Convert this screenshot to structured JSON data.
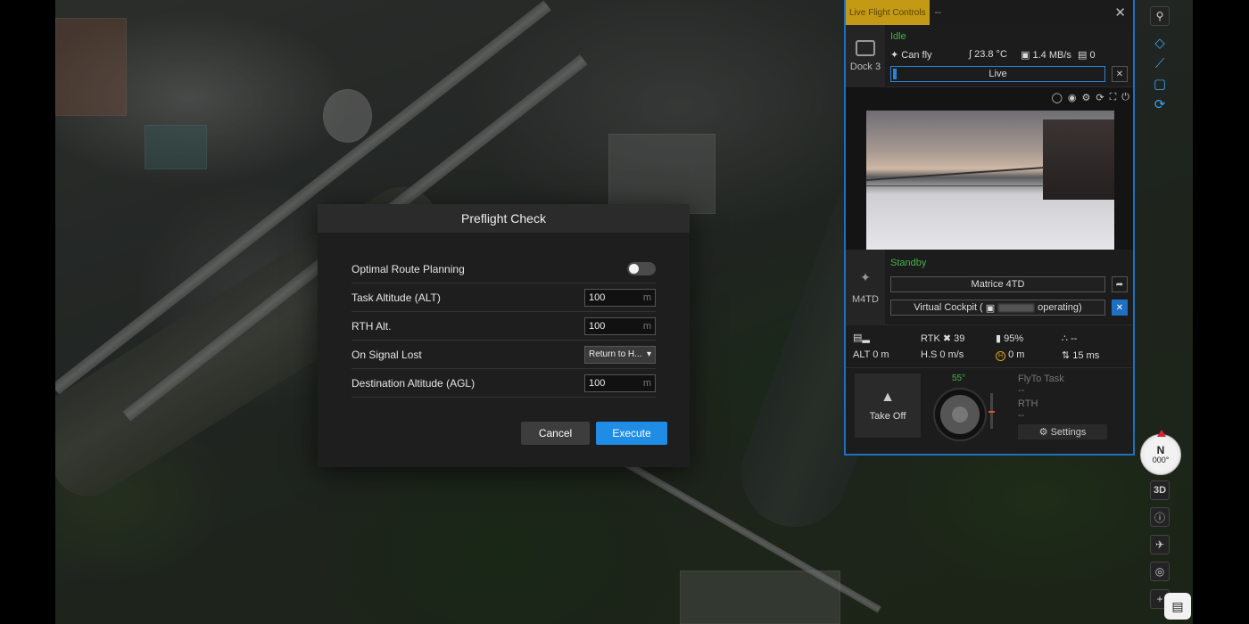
{
  "dialog": {
    "title": "Preflight Check",
    "rows": [
      {
        "label": "Optimal Route Planning",
        "type": "toggle",
        "on": false
      },
      {
        "label": "Task Altitude (ALT)",
        "value": "100",
        "unit": "m"
      },
      {
        "label": "RTH Alt.",
        "value": "100",
        "unit": "m"
      },
      {
        "label": "On Signal Lost",
        "value": "Return to H..."
      },
      {
        "label": "Destination Altitude (AGL)",
        "value": "100",
        "unit": "m"
      }
    ],
    "cancel_label": "Cancel",
    "execute_label": "Execute"
  },
  "panel": {
    "tab_label": "Live Flight Controls",
    "tab_dash": "--",
    "dock": {
      "name": "Dock 3",
      "status": "Idle",
      "can_fly": "Can fly",
      "temperature": "23.8 °C",
      "rate": "1.4 MB/s",
      "count": "0",
      "live_label": "Live"
    },
    "drone": {
      "name": "M4TD",
      "status": "Standby",
      "model": "Matrice 4TD",
      "cockpit_prefix": "Virtual Cockpit  (",
      "cockpit_suffix": "operating)"
    },
    "telemetry": {
      "alt": "ALT 0 m",
      "rtk": "RTK",
      "rtk_value": "39",
      "hs": "H.S 0 m/s",
      "battery": "95%",
      "h_label": "H",
      "h_value": "0 m",
      "link": "--",
      "latency": "15 ms"
    },
    "controls": {
      "takeoff_label": "Take Off",
      "heading": "55°",
      "flyto_label": "FlyTo Task",
      "flyto_value": "--",
      "rth_label": "RTH",
      "rth_value": "--",
      "settings_label": "Settings"
    }
  },
  "map_controls": {
    "compass_letter": "N",
    "compass_deg": "000°",
    "btn_3d": "3D"
  },
  "colors": {
    "accent_blue": "#1f8de6",
    "status_green": "#46b24a",
    "tab_gold": "#c49a14"
  }
}
